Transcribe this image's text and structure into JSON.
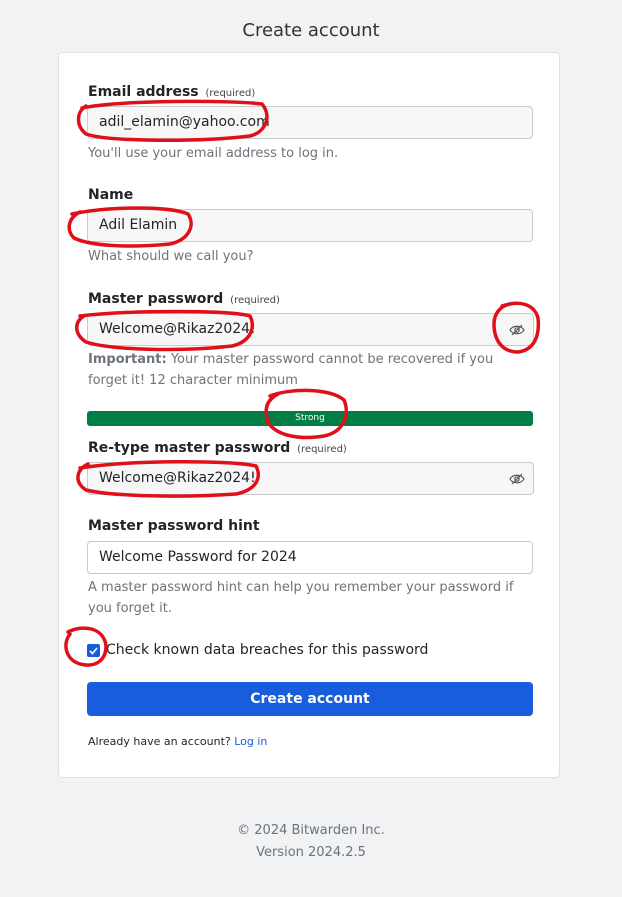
{
  "page": {
    "title": "Create account"
  },
  "form": {
    "email": {
      "label": "Email address",
      "required": "(required)",
      "value": "adil_elamin@yahoo.com",
      "hint": "You'll use your email address to log in."
    },
    "name": {
      "label": "Name",
      "value": "Adil Elamin",
      "hint": "What should we call you?"
    },
    "master_password": {
      "label": "Master password",
      "required": "(required)",
      "value": "Welcome@Rikaz2024!",
      "hint_strong": "Important:",
      "hint_rest": "Your master password cannot be recovered if you forget it! 12 character minimum",
      "toggle_icon": "eye-slash-icon"
    },
    "strength": {
      "label": "Strong",
      "level": 1.0,
      "color": "#017e45"
    },
    "retype_password": {
      "label": "Re-type master password",
      "required": "(required)",
      "value": "Welcome@Rikaz2024!",
      "toggle_icon": "eye-slash-icon"
    },
    "password_hint": {
      "label": "Master password hint",
      "value": "Welcome Password for 2024",
      "hint": "A master password hint can help you remember your password if you forget it."
    },
    "breach_check": {
      "label": "Check known data breaches for this password",
      "checked": true
    },
    "submit_label": "Create account",
    "login_prompt": "Already have an account?",
    "login_link": "Log in"
  },
  "footer": {
    "copyright": "© 2024 Bitwarden Inc.",
    "version": "Version 2024.2.5"
  },
  "colors": {
    "primary": "#175ddc",
    "success": "#017e45",
    "annotation": "#e0101a"
  }
}
